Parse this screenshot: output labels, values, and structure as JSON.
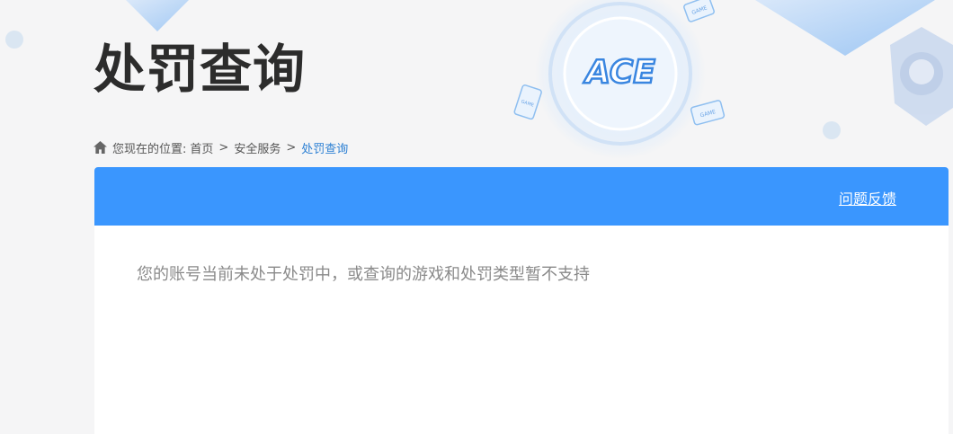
{
  "page": {
    "title": "处罚查询"
  },
  "logo": {
    "text": "ACE",
    "badge_text": "GAME"
  },
  "breadcrumb": {
    "prefix": "您现在的位置:",
    "items": [
      "首页",
      "安全服务",
      "处罚查询"
    ],
    "separator": ">"
  },
  "panel": {
    "feedback_label": "问题反馈",
    "message": "您的账号当前未处于处罚中，或查询的游戏和处罚类型暂不支持"
  },
  "colors": {
    "header_blue": "#3a96fe",
    "current_crumb": "#2b7fd3",
    "title": "#2c2c2c",
    "message": "#8a8a8a"
  }
}
